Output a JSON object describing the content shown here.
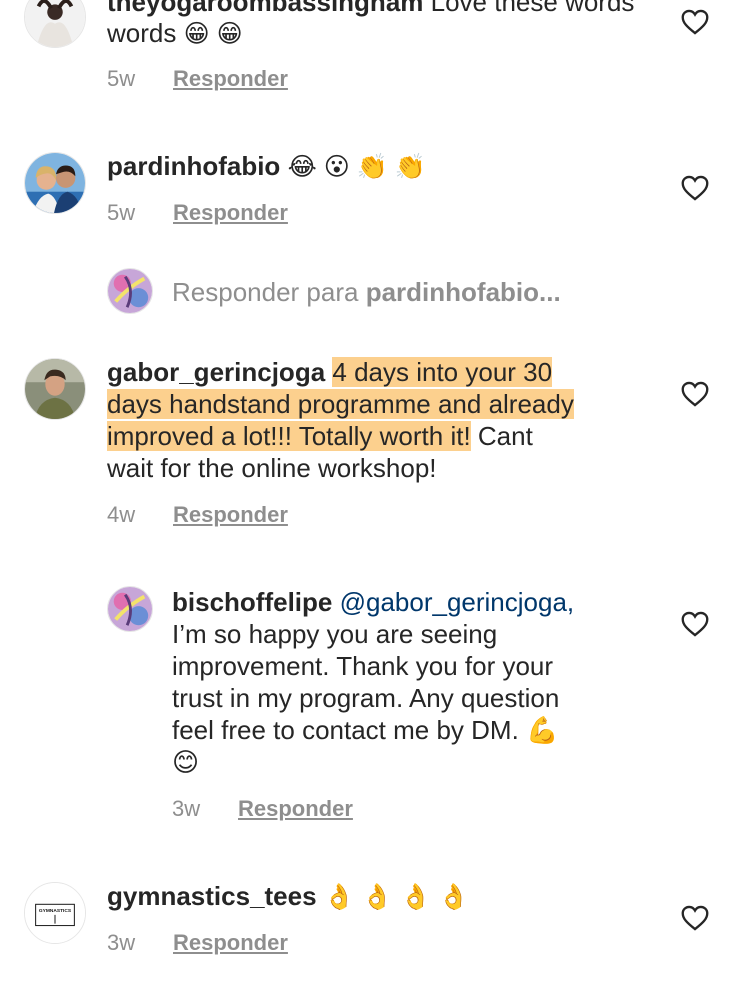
{
  "comments": [
    {
      "username": "theyogaroombassingham",
      "text": "Love these words",
      "emojis": "😁 😁",
      "time": "5w",
      "reply": "Responder"
    },
    {
      "username": "pardinhofabio",
      "text": "",
      "emojis": "😂 😮 👏 👏",
      "time": "5w",
      "reply": "Responder"
    },
    {
      "username": "gabor_gerincjoga",
      "text_highlight_1": "4 days into your 30",
      "text_highlight_2": "days handstand programme and already",
      "text_highlight_3": "improved a lot!!! Totally worth it!",
      "text_rest_3": " Cant",
      "text_line_4": "wait for the online workshop!",
      "time": "4w",
      "reply": "Responder"
    },
    {
      "username": "bischoffelipe",
      "mention": "@gabor_gerincjoga,",
      "line_2": "I’m so happy you are seeing",
      "line_3": "improvement. Thank you for your",
      "line_4": "trust in my program. Any question",
      "line_5": "feel free to contact me by DM. 💪",
      "line_6": "😊",
      "time": "3w",
      "reply": "Responder"
    },
    {
      "username": "gymnastics_tees",
      "emojis": "👌 👌 👌 👌",
      "time": "3w",
      "reply": "Responder"
    }
  ],
  "reply_prompt": {
    "prefix": "Responder para",
    "target": "pardinhofabio..."
  },
  "avatars": {
    "gymnastics_tees_logo": "GYMNASTICS"
  },
  "colors": {
    "highlight": "#fcd08e",
    "mention": "#00376b",
    "secondary_text": "#8e8e8e"
  },
  "icons": {
    "like": "heart-outline-icon"
  }
}
